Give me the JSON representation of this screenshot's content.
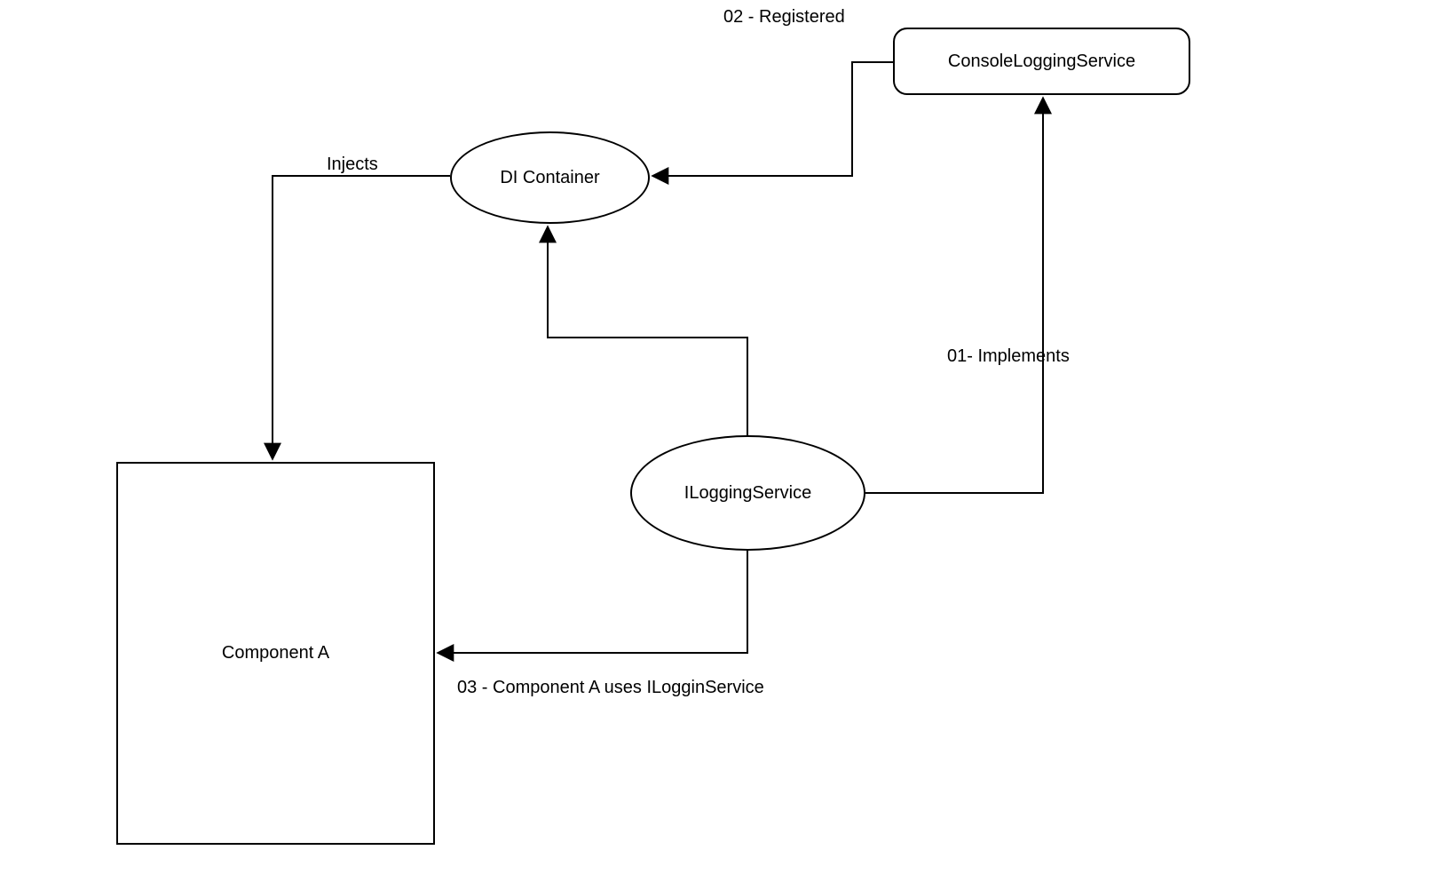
{
  "nodes": {
    "console_logging_service": {
      "label": "ConsoleLoggingService"
    },
    "di_container": {
      "label": "DI Container"
    },
    "ilogging_service": {
      "label": "ILoggingService"
    },
    "component_a": {
      "label": "Component A"
    }
  },
  "edges": {
    "registered": {
      "label": "02 - Registered"
    },
    "implements": {
      "label": "01- Implements"
    },
    "injects": {
      "label": "Injects"
    },
    "uses": {
      "label": "03 - Component A uses ILogginService"
    }
  }
}
